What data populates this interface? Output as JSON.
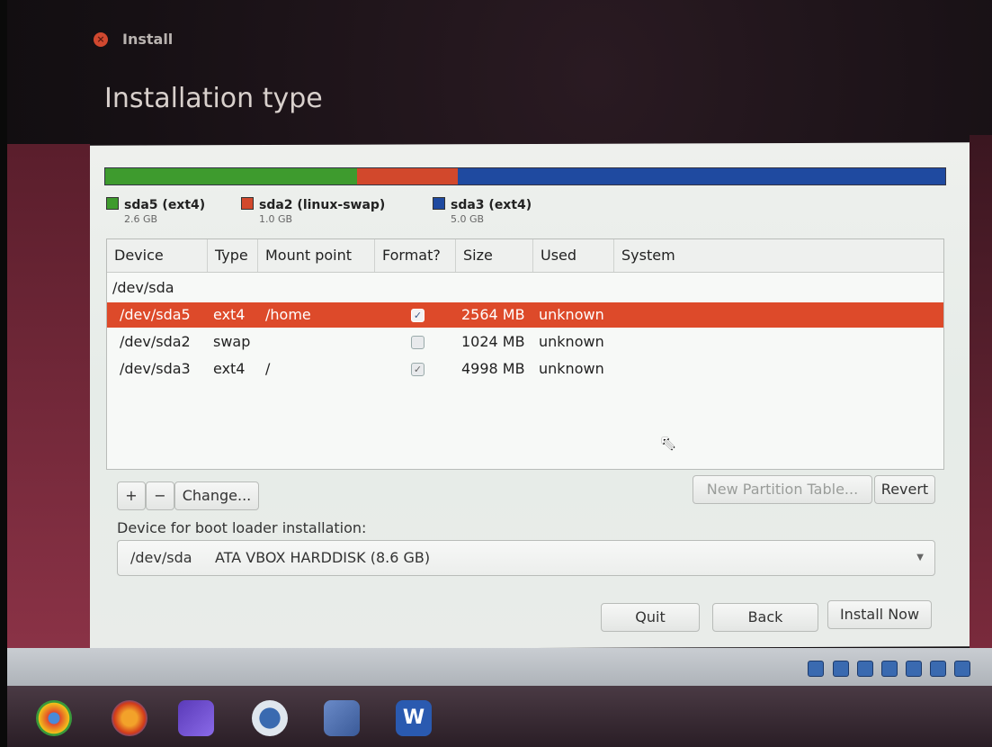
{
  "window": {
    "title": "Install",
    "page_title": "Installation type"
  },
  "partition_bar": {
    "segments": [
      {
        "name": "sda5 (ext4)",
        "size": "2.6 GB",
        "color": "#3e9b2e",
        "fraction": 0.3
      },
      {
        "name": "sda2 (linux-swap)",
        "size": "1.0 GB",
        "color": "#d2482c",
        "fraction": 0.12
      },
      {
        "name": "sda3 (ext4)",
        "size": "5.0 GB",
        "color": "#1f4aa0",
        "fraction": 0.58
      }
    ]
  },
  "table": {
    "headers": [
      "Device",
      "Type",
      "Mount point",
      "Format?",
      "Size",
      "Used",
      "System"
    ],
    "disk": "/dev/sda",
    "rows": [
      {
        "device": "/dev/sda5",
        "type": "ext4",
        "mount": "/home",
        "format": true,
        "size": "2564 MB",
        "used": "unknown",
        "selected": true
      },
      {
        "device": "/dev/sda2",
        "type": "swap",
        "mount": "",
        "format": false,
        "size": "1024 MB",
        "used": "unknown",
        "selected": false
      },
      {
        "device": "/dev/sda3",
        "type": "ext4",
        "mount": "/",
        "format": true,
        "size": "4998 MB",
        "used": "unknown",
        "selected": false
      }
    ]
  },
  "buttons": {
    "add": "+",
    "remove": "−",
    "change": "Change...",
    "new_partition_table": "New Partition Table...",
    "revert": "Revert",
    "quit": "Quit",
    "back": "Back",
    "install_now": "Install Now"
  },
  "boot_loader": {
    "label": "Device for boot loader installation:",
    "device": "/dev/sda",
    "description": "ATA VBOX HARDDISK (8.6 GB)"
  },
  "checkmark": "✓",
  "taskbar": {
    "icons": [
      "chrome-icon",
      "firefox-icon",
      "visual-studio-icon",
      "virtualbox-icon",
      "package-icon",
      "word-icon"
    ],
    "word_label": "W"
  }
}
